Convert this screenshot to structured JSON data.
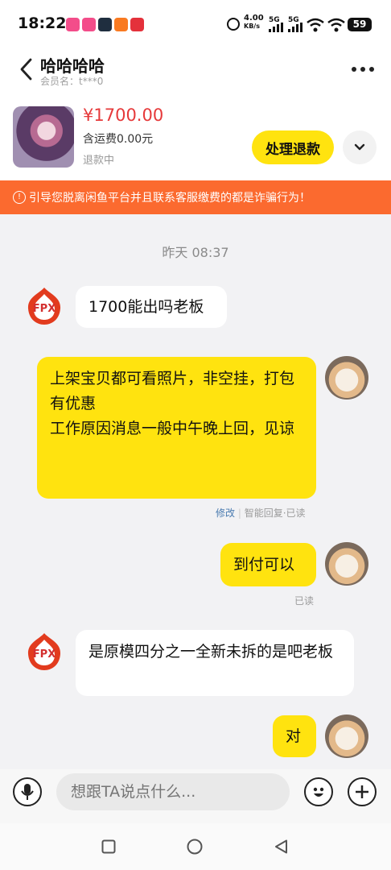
{
  "status_bar": {
    "time": "18:22",
    "net_speed": "4.00",
    "net_unit": "KB/s",
    "signal1": "5G",
    "signal2": "5G",
    "battery": "59"
  },
  "header": {
    "title": "哈哈哈哈",
    "subtitle": "会员名：t***0"
  },
  "product": {
    "price": "¥1700.00",
    "shipping": "含运费0.00元",
    "status": "退款中",
    "refund_button": "处理退款"
  },
  "warning": {
    "text": "引导您脱离闲鱼平台并且联系客服缴费的都是诈骗行为！"
  },
  "chat": {
    "timestamp": "昨天 08:37",
    "messages": [
      {
        "side": "left",
        "text": "1700能出吗老板"
      },
      {
        "side": "right",
        "text": "上架宝贝都可看照片，非空挂，打包有优惠\n工作原因消息一般中午晚上回，见谅",
        "meta_edit": "修改",
        "meta_status": "智能回复·已读"
      },
      {
        "side": "right",
        "text": "到付可以",
        "meta_status": "已读"
      },
      {
        "side": "left",
        "text": "是原模四分之一全新未拆的是吧老板"
      },
      {
        "side": "right",
        "text": "对"
      }
    ],
    "fpx_label": "FPX"
  },
  "input": {
    "placeholder": "想跟TA说点什么..."
  },
  "colors": {
    "accent_yellow": "#ffe30f",
    "warning_orange": "#fb6a2f",
    "price_red": "#e6393a"
  },
  "icons": [
    "back-arrow-icon",
    "more-icon",
    "chevron-down-icon",
    "warning-icon",
    "voice-icon",
    "emoji-icon",
    "plus-icon",
    "nav-square-icon",
    "nav-circle-icon",
    "nav-back-icon"
  ]
}
